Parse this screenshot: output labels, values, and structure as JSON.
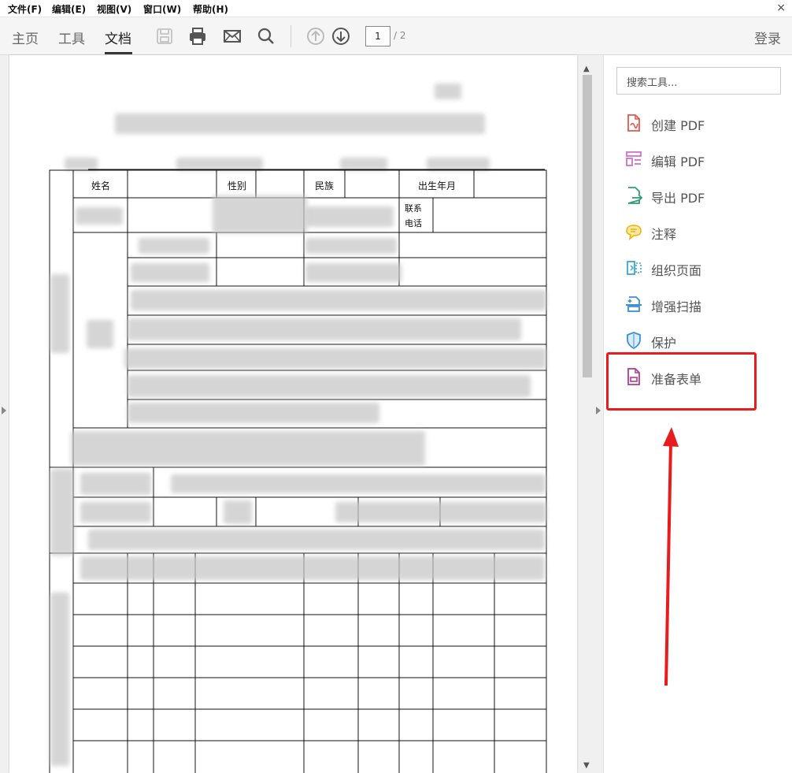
{
  "menubar": {
    "items": [
      "文件(F)",
      "编辑(E)",
      "视图(V)",
      "窗口(W)",
      "帮助(H)"
    ],
    "close": "×"
  },
  "toolbar": {
    "tabs": [
      "主页",
      "工具",
      "文档"
    ],
    "active_tab": "文档",
    "page_current": "1",
    "page_total": "/ 2",
    "login": "登录",
    "icons": [
      "save-icon",
      "print-icon",
      "email-icon",
      "search-icon",
      "page-up-icon",
      "page-down-icon"
    ]
  },
  "document": {
    "labels": {
      "name": "姓名",
      "gender": "性别",
      "ethnicity": "民族",
      "birth": "出生年月",
      "contact1": "联系",
      "contact2": "电话"
    }
  },
  "scrollbar": {
    "up": "▲",
    "down": "▼"
  },
  "side_panel": {
    "search_placeholder": "搜索工具...",
    "tools": [
      {
        "label": "创建 PDF",
        "icon": "create-pdf-icon",
        "color": "#e0584e"
      },
      {
        "label": "编辑 PDF",
        "icon": "edit-pdf-icon",
        "color": "#d36fcf"
      },
      {
        "label": "导出 PDF",
        "icon": "export-pdf-icon",
        "color": "#2e9c78"
      },
      {
        "label": "注释",
        "icon": "comment-icon",
        "color": "#f0b400"
      },
      {
        "label": "组织页面",
        "icon": "organize-pages-icon",
        "color": "#3ba6d8"
      },
      {
        "label": "增强扫描",
        "icon": "enhance-scan-icon",
        "color": "#3a8fd6"
      },
      {
        "label": "保护",
        "icon": "shield-icon",
        "color": "#3a8fd6"
      },
      {
        "label": "准备表单",
        "icon": "prepare-form-icon",
        "color": "#b03d8f"
      }
    ],
    "annotation_color": "#e81c1c"
  }
}
